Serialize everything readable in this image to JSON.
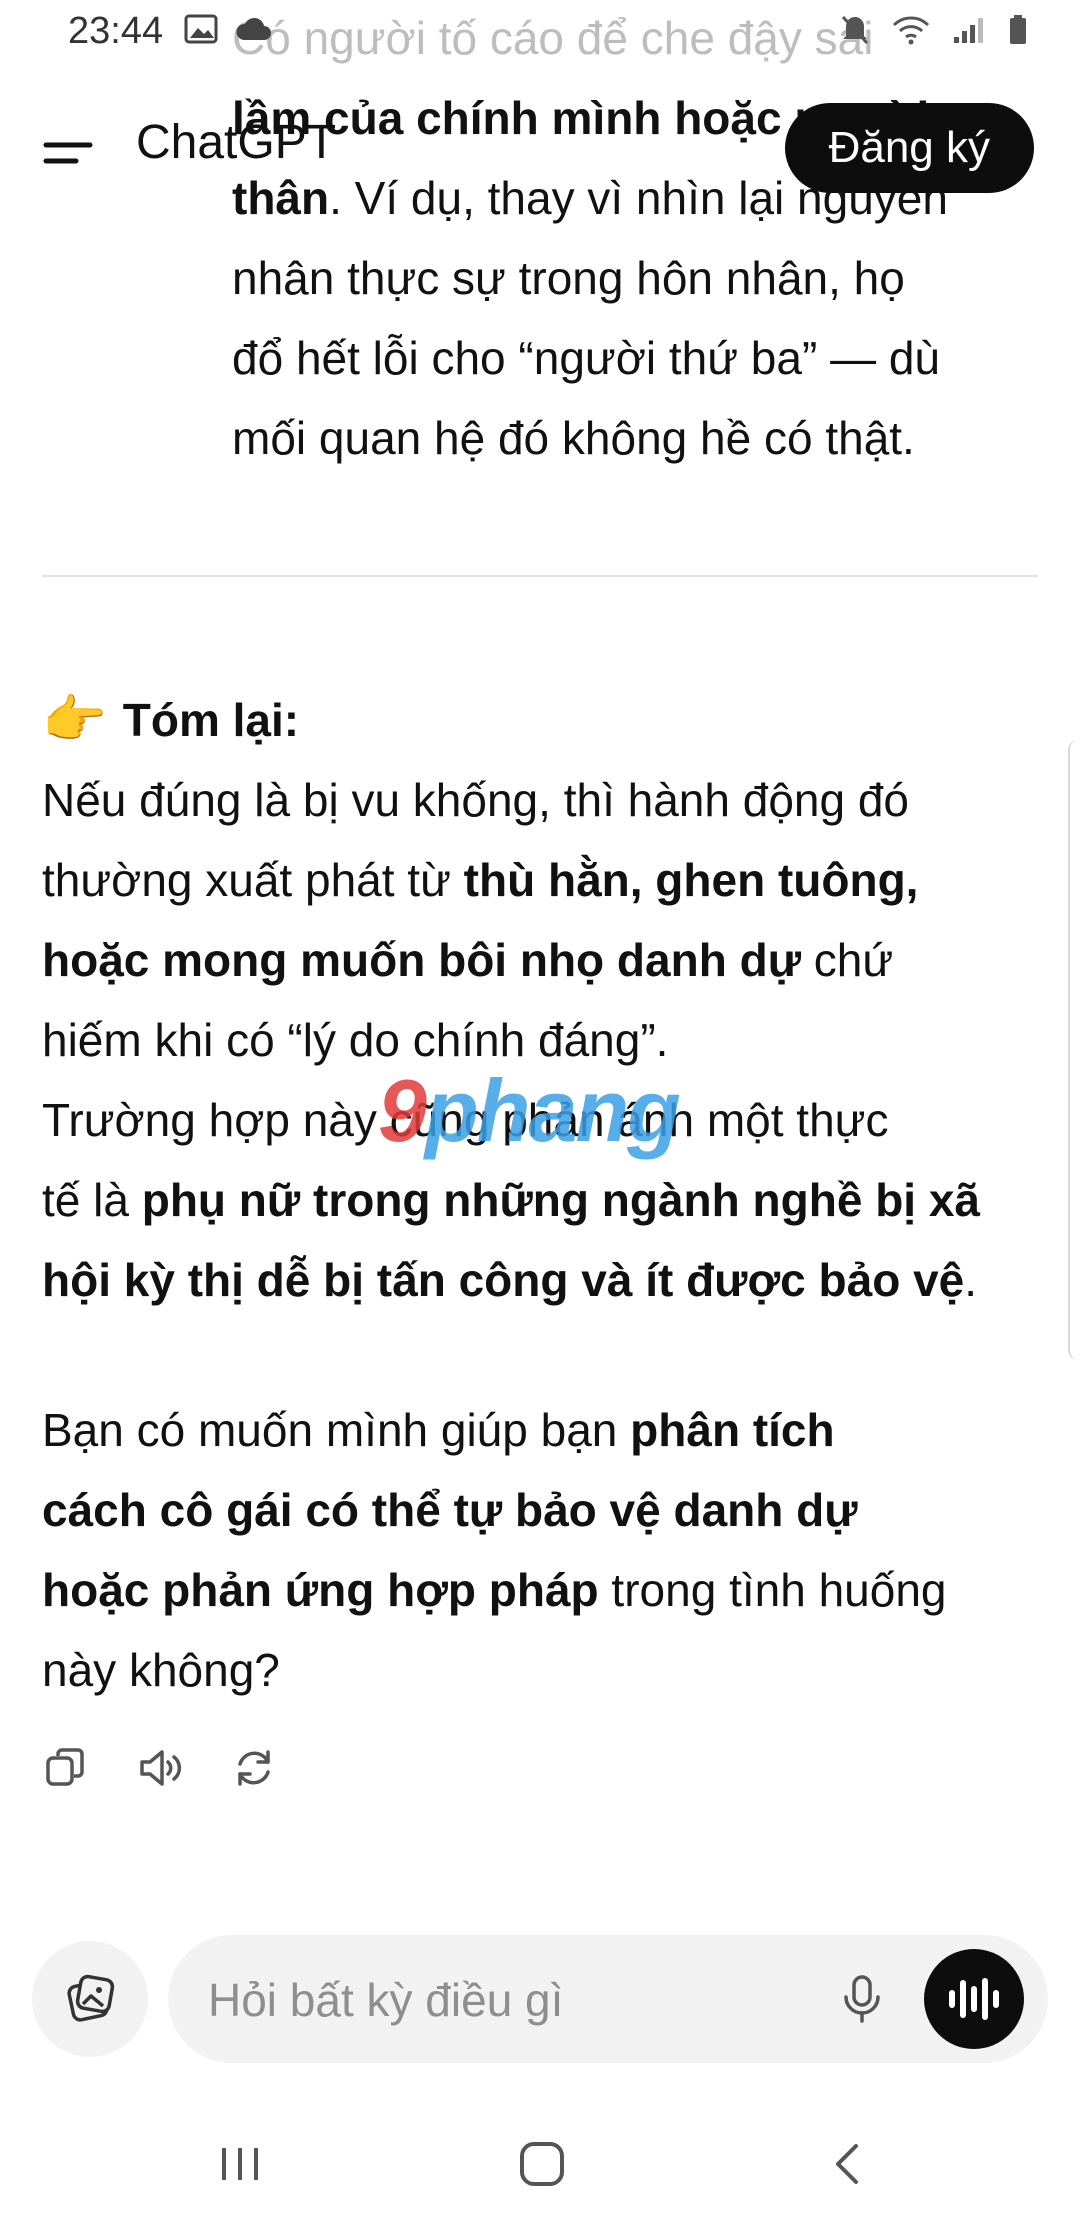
{
  "status_bar": {
    "time": "23:44"
  },
  "header": {
    "title": "ChatGPT",
    "signup_label": "Đăng ký"
  },
  "message": {
    "faded_line": "Có người tố cáo để che đậy sai",
    "line1_bold": "lầm của chính mình hoặc người",
    "line2_bold": "thân",
    "line2_rest": ". Ví dụ, thay vì nhìn lại nguyên",
    "line3": "nhân thực sự trong hôn nhân, họ",
    "line4": "đổ hết lỗi cho “người thứ ba” — dù",
    "line5": "mối quan hệ đó không hề có thật."
  },
  "summary": {
    "emoji": "👉",
    "heading": "Tóm lại:",
    "p1_a": "Nếu đúng là bị vu khống, thì hành động đó",
    "p1_b": "thường xuất phát từ ",
    "p1_b_bold": "thù hằn, ghen tuông,",
    "p1_c_bold": "hoặc mong muốn bôi nhọ danh dự",
    "p1_c_rest": " chứ",
    "p1_d": "hiếm khi có “lý do chính đáng”.",
    "p2_a": "Trường hợp này cũng phản ánh một thực",
    "p2_b": "tế là ",
    "p2_b_bold": "phụ nữ trong những ngành nghề bị xã",
    "p2_c_bold": "hội kỳ thị dễ bị tấn công và ít được bảo vệ",
    "p2_c_rest": "."
  },
  "question": {
    "a": "Bạn có muốn mình giúp bạn ",
    "a_bold": "phân tích",
    "b_bold": "cách cô gái có thể tự bảo vệ danh dự",
    "c_bold": "hoặc phản ứng hợp pháp",
    "c_rest": " trong tình huống",
    "d": "này không?"
  },
  "watermark": {
    "part_a": "9",
    "part_b": "phang"
  },
  "composer": {
    "placeholder": "Hỏi bất kỳ điều gì"
  }
}
